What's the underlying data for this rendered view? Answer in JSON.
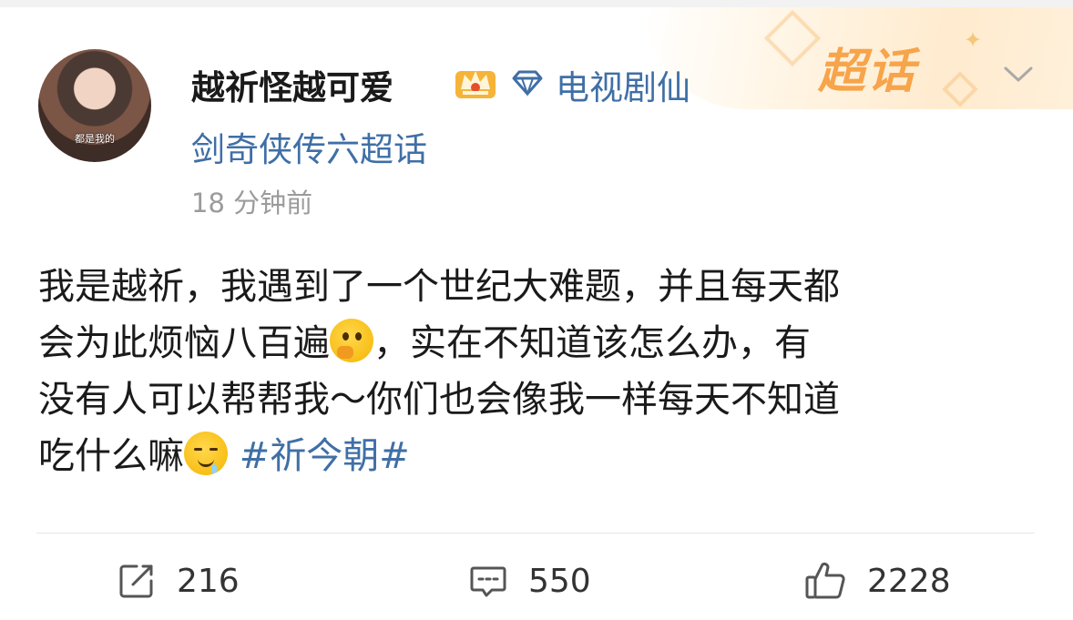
{
  "post": {
    "username": "越祈怪越可爱",
    "topic_line1": "电视剧仙",
    "topic_line2": "剑奇侠传六超话",
    "timestamp": "18 分钟前",
    "avatar_caption": "都是我的",
    "supertopic_badge": "超话",
    "body_lines": [
      "我是越祈，我遇到了一个世纪大难题，并且每天都",
      "会为此烦恼八百遍",
      "，实在不知道该怎么办，有",
      "没有人可以帮帮我～你们也会像我一样每天不知道",
      "吃什么嘛"
    ],
    "hashtag": "#祈今朝#"
  },
  "icons": {
    "crown": "crown-badge-icon",
    "diamond": "diamond-icon",
    "thinking_emoji": "thinking-face-emoji",
    "drooling_emoji": "drooling-face-emoji",
    "chevron": "chevron-down-icon"
  },
  "actions": {
    "repost_count": "216",
    "comment_count": "550",
    "like_count": "2228"
  },
  "colors": {
    "link": "#3f6fa6",
    "text": "#1a1a1a",
    "muted": "#9b9b9b",
    "supertopic_orange": "#f7a44a"
  }
}
